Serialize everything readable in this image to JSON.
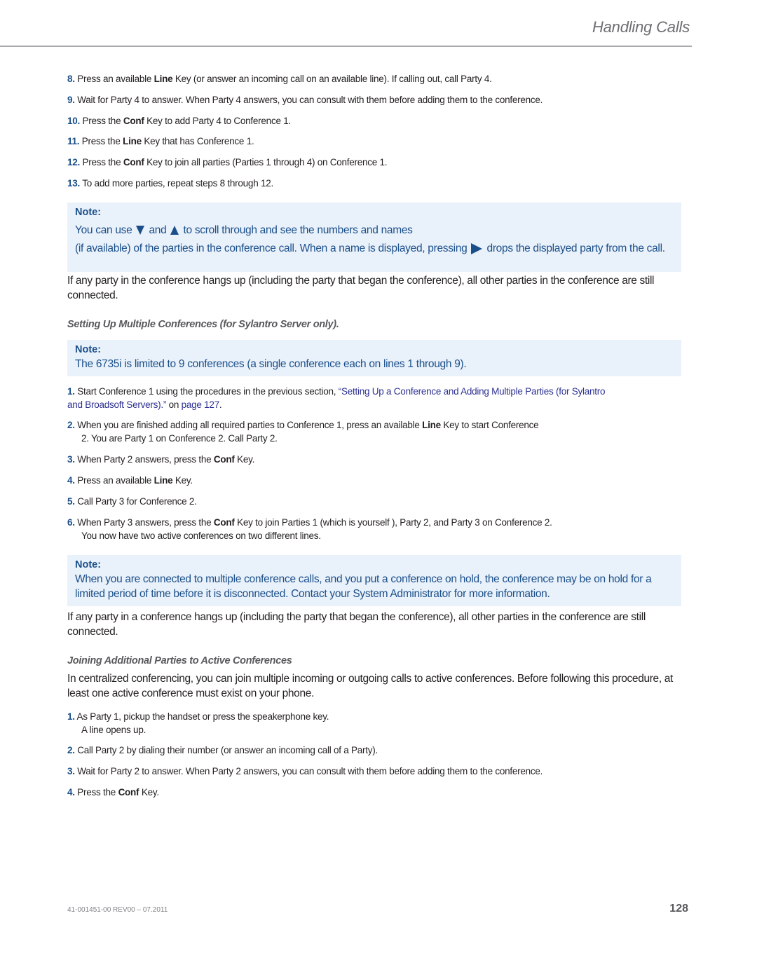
{
  "header": {
    "title": "Handling Calls"
  },
  "steps_a": [
    {
      "num": "8.",
      "parts": [
        "Press an available ",
        "Line",
        " Key (or answer an incoming call on an available line). If calling out, call Party 4."
      ]
    },
    {
      "num": "9.",
      "text": "Wait for Party 4 to answer. When Party 4 answers, you can consult with them before adding them to the conference."
    },
    {
      "num": "10.",
      "parts": [
        "Press the ",
        "Conf",
        " Key to add Party 4 to Conference 1."
      ]
    },
    {
      "num": "11.",
      "parts": [
        "Press the ",
        "Line",
        " Key that has Conference 1."
      ]
    },
    {
      "num": "12.",
      "parts": [
        "Press the ",
        "Conf",
        " Key to join all parties (Parties 1 through 4) on Conference 1."
      ]
    },
    {
      "num": "13.",
      "text": "To add more parties, repeat steps 8 through 12."
    }
  ],
  "note1": {
    "label": "Note:",
    "line1_a": "You can use",
    "line1_b": "and",
    "line1_c": "to scroll through and see the numbers and names",
    "line2_a": "(if available) of the parties in the conference call. When a name is displayed, pressing",
    "line2_b": "drops the displayed party from the call.",
    "icons": [
      "arrow-down-icon",
      "arrow-up-icon",
      "arrow-right-icon"
    ]
  },
  "para1": "If any party in the conference hangs up (including the party that began the conference), all other parties in the conference are still connected.",
  "subhead1": "Setting Up Multiple Conferences (for Sylantro Server only).",
  "note2": {
    "label": "Note:",
    "text": "The 6735i is limited to 9 conferences (a single conference each on lines 1 through 9)."
  },
  "steps_b": [
    {
      "num": "1.",
      "pre": "Start Conference 1 using the procedures in the previous section, ",
      "link": "“Setting Up a Conference and Adding Multiple Parties (for Sylantro and Broadsoft Servers).”",
      "mid": " on ",
      "link2": "page 127",
      "post": "."
    },
    {
      "num": "2.",
      "parts": [
        "When you are finished adding all required parties to Conference 1, press an available ",
        "Line",
        " Key to start Conference"
      ],
      "cont": "2. You are Party 1 on Conference 2. Call Party 2."
    },
    {
      "num": "3.",
      "parts": [
        "When Party 2 answers, press the ",
        "Conf",
        " Key."
      ]
    },
    {
      "num": "4.",
      "parts": [
        "Press an available ",
        "Line",
        " Key."
      ]
    },
    {
      "num": "5.",
      "text": "Call Party 3 for Conference 2."
    },
    {
      "num": "6.",
      "parts": [
        "When Party 3 answers, press the ",
        "Conf",
        " Key to join Parties 1 (which is yourself ), Party 2, and Party 3 on Conference 2."
      ],
      "cont": "You now have two active conferences on two different lines."
    }
  ],
  "note3": {
    "label": "Note:",
    "text": "When you are connected to multiple conference calls, and you put a conference on hold, the conference may be on hold for a limited period of time before it is disconnected. Contact your System Administrator for more information."
  },
  "para2": "If any party in a conference hangs up (including the party that began the conference), all other parties in the conference are still connected.",
  "subhead2": "Joining Additional Parties to Active Conferences",
  "para3": "In centralized conferencing, you can join multiple incoming or outgoing calls to active conferences. Before following this procedure, at least one active conference must exist on your phone.",
  "steps_c": [
    {
      "num": "1.",
      "text": "As Party 1, pickup the handset or press the speakerphone key.",
      "cont": "A line opens up."
    },
    {
      "num": "2.",
      "text": "Call Party 2 by dialing their number (or answer an incoming call of a Party)."
    },
    {
      "num": "3.",
      "text": "Wait for Party 2 to answer. When Party 2 answers, you can consult with them before adding them to the conference."
    },
    {
      "num": "4.",
      "parts": [
        "Press the ",
        "Conf",
        " Key."
      ]
    }
  ],
  "footer": {
    "doc_id": "41-001451-00 REV00 – 07.2011",
    "page_number": "128"
  }
}
